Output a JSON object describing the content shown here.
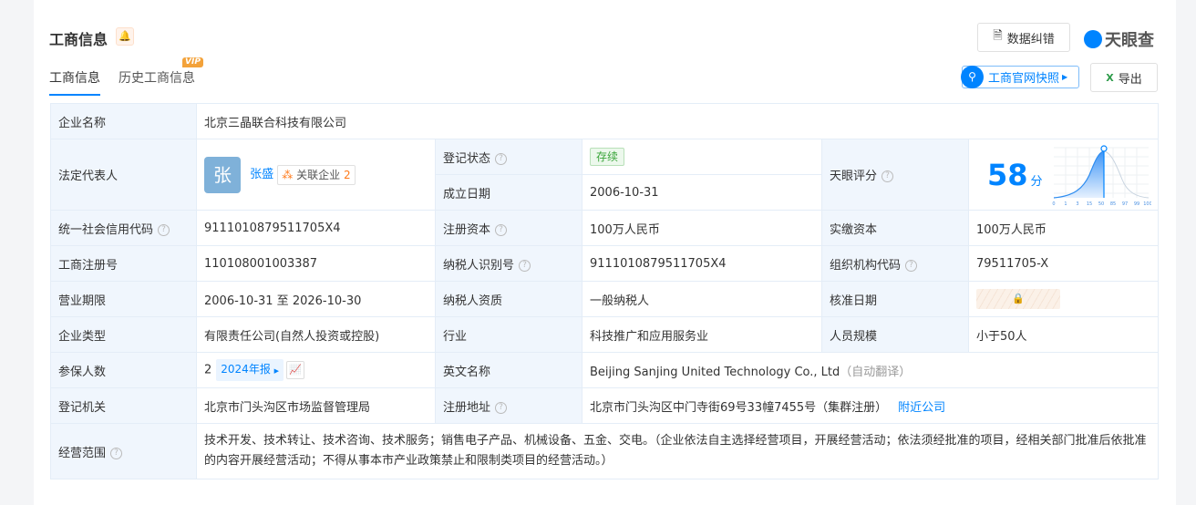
{
  "header": {
    "title": "工商信息",
    "correction_button": "数据纠错",
    "logo": "天眼查",
    "snapshot_button": "工商官网快照",
    "export_button": "导出"
  },
  "tabs": [
    {
      "label": "工商信息"
    },
    {
      "label": "历史工商信息",
      "badge": "VIP"
    }
  ],
  "rows": {
    "company_name": {
      "label": "企业名称",
      "value": "北京三晶联合科技有限公司"
    },
    "legal_rep": {
      "label": "法定代表人",
      "avatar": "张",
      "name": "张盛",
      "related_label": "关联企业",
      "related_count": "2"
    },
    "reg_status": {
      "label": "登记状态",
      "value": "存续"
    },
    "founded": {
      "label": "成立日期",
      "value": "2006-10-31"
    },
    "score": {
      "label": "天眼评分",
      "value": "58",
      "unit": "分",
      "ticks": [
        "0",
        "1",
        "3",
        "15",
        "50",
        "85",
        "97",
        "99",
        "100"
      ]
    },
    "credit_code": {
      "label": "统一社会信用代码",
      "value": "9111010879511705X4"
    },
    "reg_capital": {
      "label": "注册资本",
      "value": "100万人民币"
    },
    "paid_capital": {
      "label": "实缴资本",
      "value": "100万人民币"
    },
    "reg_no": {
      "label": "工商注册号",
      "value": "110108001003387"
    },
    "taxpayer_id": {
      "label": "纳税人识别号",
      "value": "9111010879511705X4"
    },
    "org_code": {
      "label": "组织机构代码",
      "value": "79511705-X"
    },
    "term": {
      "label": "营业期限",
      "value": "2006-10-31 至 2026-10-30"
    },
    "taxpayer_type": {
      "label": "纳税人资质",
      "value": "一般纳税人"
    },
    "approval_date": {
      "label": "核准日期"
    },
    "company_type": {
      "label": "企业类型",
      "value": "有限责任公司(自然人投资或控股)"
    },
    "industry": {
      "label": "行业",
      "value": "科技推广和应用服务业"
    },
    "staff_size": {
      "label": "人员规模",
      "value": "小于50人"
    },
    "insured": {
      "label": "参保人数",
      "value": "2",
      "report": "2024年报"
    },
    "english_name": {
      "label": "英文名称",
      "value": "Beijing Sanjing United Technology Co., Ltd",
      "note": "（自动翻译）"
    },
    "authority": {
      "label": "登记机关",
      "value": "北京市门头沟区市场监督管理局"
    },
    "address": {
      "label": "注册地址",
      "value": "北京市门头沟区中门寺街69号33幢7455号（集群注册）",
      "nearby": "附近公司"
    },
    "scope": {
      "label": "经营范围",
      "value": "技术开发、技术转让、技术咨询、技术服务；销售电子产品、机械设备、五金、交电。（企业依法自主选择经营项目，开展经营活动；依法须经批准的项目，经相关部门批准后依批准的内容开展经营活动；不得从事本市产业政策禁止和限制类项目的经营活动。）"
    }
  },
  "colors": {
    "accent": "#0084ff",
    "label_bg": "#f0f6fd"
  }
}
